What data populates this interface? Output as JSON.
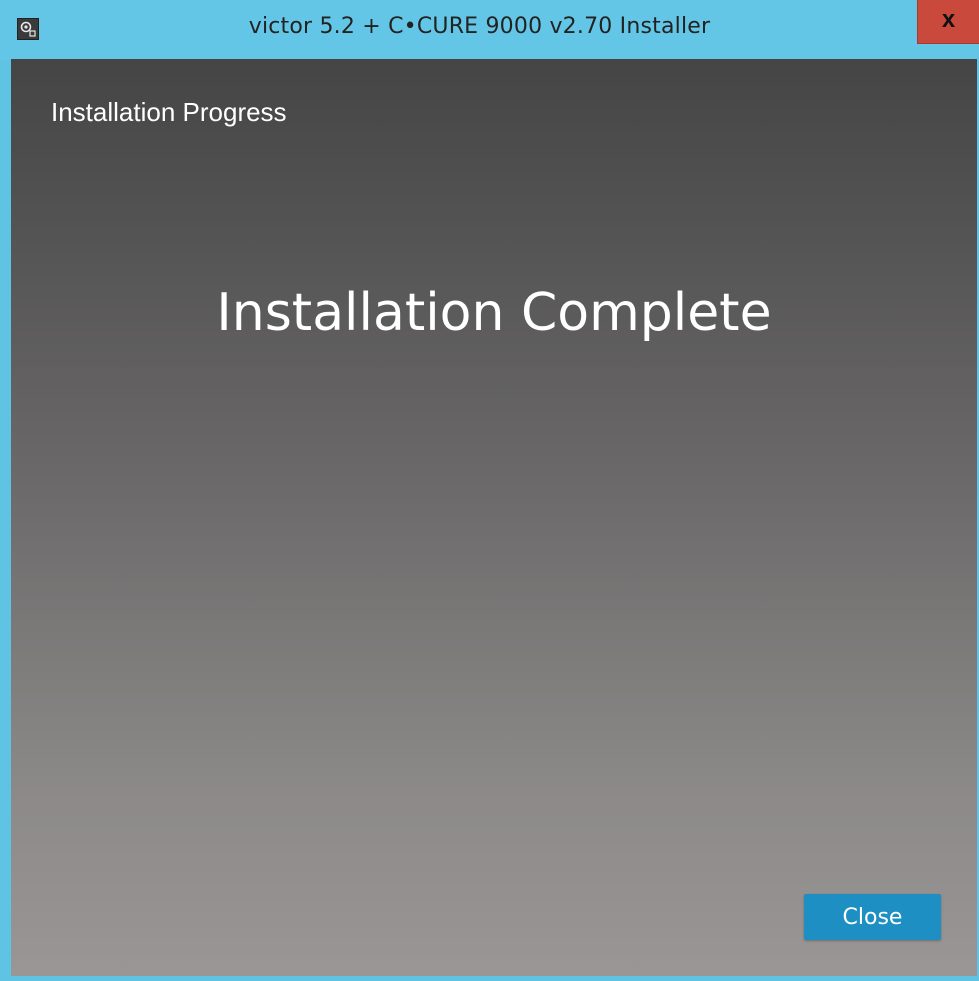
{
  "window": {
    "title": "victor 5.2 + C•CURE 9000 v2.70 Installer",
    "close_glyph": "x",
    "app_icon": "installer-app-icon"
  },
  "content": {
    "section_label": "Installation Progress",
    "status": "Installation Complete"
  },
  "actions": {
    "close_label": "Close"
  },
  "colors": {
    "titlebar": "#64c6e6",
    "close_x_bg": "#c9493d",
    "button_accent": "#1e8fc2",
    "content_top": "#454545",
    "content_bottom": "#9a9696"
  }
}
